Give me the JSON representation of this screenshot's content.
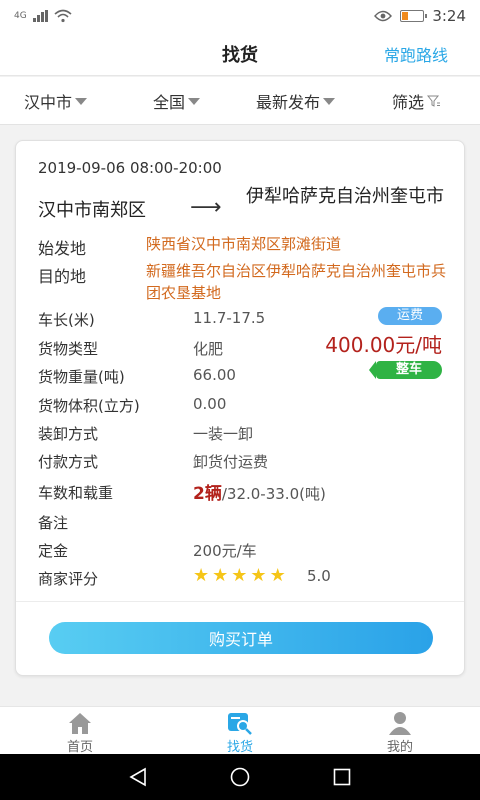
{
  "status_bar": {
    "network": "4G",
    "time": "3:24"
  },
  "header": {
    "title": "找货",
    "right_link": "常跑路线"
  },
  "filters": [
    {
      "label": "汉中市"
    },
    {
      "label": "全国"
    },
    {
      "label": "最新发布"
    },
    {
      "label": "筛选"
    }
  ],
  "order": {
    "time": "2019-09-06 08:00-20:00",
    "from": "汉中市南郑区",
    "arrow": "⟶",
    "to": "伊犁哈萨克自治州奎屯市",
    "origin_label": "始发地",
    "origin_value": "陕西省汉中市南郑区郭滩街道",
    "dest_label": "目的地",
    "dest_value": "新疆维吾尔自治区伊犁哈萨克自治州奎屯市兵团农垦基地",
    "fee_badge": "运费",
    "price": "400.00元/吨",
    "whole_badge": "整车",
    "rows": [
      {
        "label": "车长(米)",
        "value": "11.7-17.5"
      },
      {
        "label": "货物类型",
        "value": "化肥"
      },
      {
        "label": "货物重量(吨)",
        "value": "66.00"
      },
      {
        "label": "货物体积(立方)",
        "value": "0.00"
      },
      {
        "label": "装卸方式",
        "value": "一装一卸"
      },
      {
        "label": "付款方式",
        "value": "卸货付运费"
      },
      {
        "label": "车数和载重",
        "value": ""
      },
      {
        "label": "备注",
        "value": ""
      },
      {
        "label": "定金",
        "value": "200元/车"
      },
      {
        "label": "商家评分",
        "value": ""
      }
    ],
    "vehicle_count": "2辆",
    "vehicle_load": "/32.0-33.0(吨)",
    "rating_stars": 5,
    "rating_score": "5.0",
    "buy_button": "购买订单"
  },
  "bottom_nav": [
    {
      "label": "首页",
      "icon": "home-icon"
    },
    {
      "label": "找货",
      "icon": "find-goods-icon",
      "active": true
    },
    {
      "label": "我的",
      "icon": "profile-icon"
    }
  ],
  "colors": {
    "accent": "#2aa7e6",
    "price_red": "#b3221c",
    "address_orange": "#d2691e",
    "badge_green": "#2fb344"
  }
}
